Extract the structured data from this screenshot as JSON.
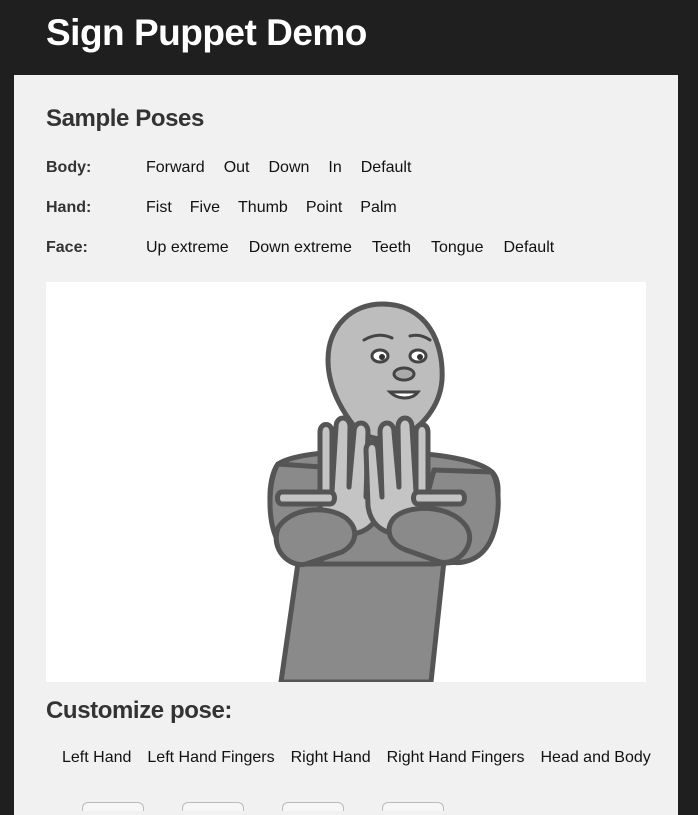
{
  "page": {
    "title": "Sign Puppet Demo"
  },
  "sample_poses": {
    "heading": "Sample Poses",
    "body": {
      "label": "Body:",
      "options": [
        "Forward",
        "Out",
        "Down",
        "In",
        "Default"
      ]
    },
    "hand": {
      "label": "Hand:",
      "options": [
        "Fist",
        "Five",
        "Thumb",
        "Point",
        "Palm"
      ]
    },
    "face": {
      "label": "Face:",
      "options": [
        "Up extreme",
        "Down extreme",
        "Teeth",
        "Tongue",
        "Default"
      ]
    }
  },
  "customize": {
    "heading": "Customize pose:",
    "tabs": [
      "Left Hand",
      "Left Hand Fingers",
      "Right Hand",
      "Right Hand Fingers",
      "Head and Body"
    ]
  },
  "colors": {
    "header_bg": "#1f1f1f",
    "panel_bg": "#f1f1f1",
    "puppet_body": "#8a8a8a",
    "puppet_face": "#bdbdbd",
    "puppet_hands": "#c4c4c4",
    "outline": "#555555"
  }
}
